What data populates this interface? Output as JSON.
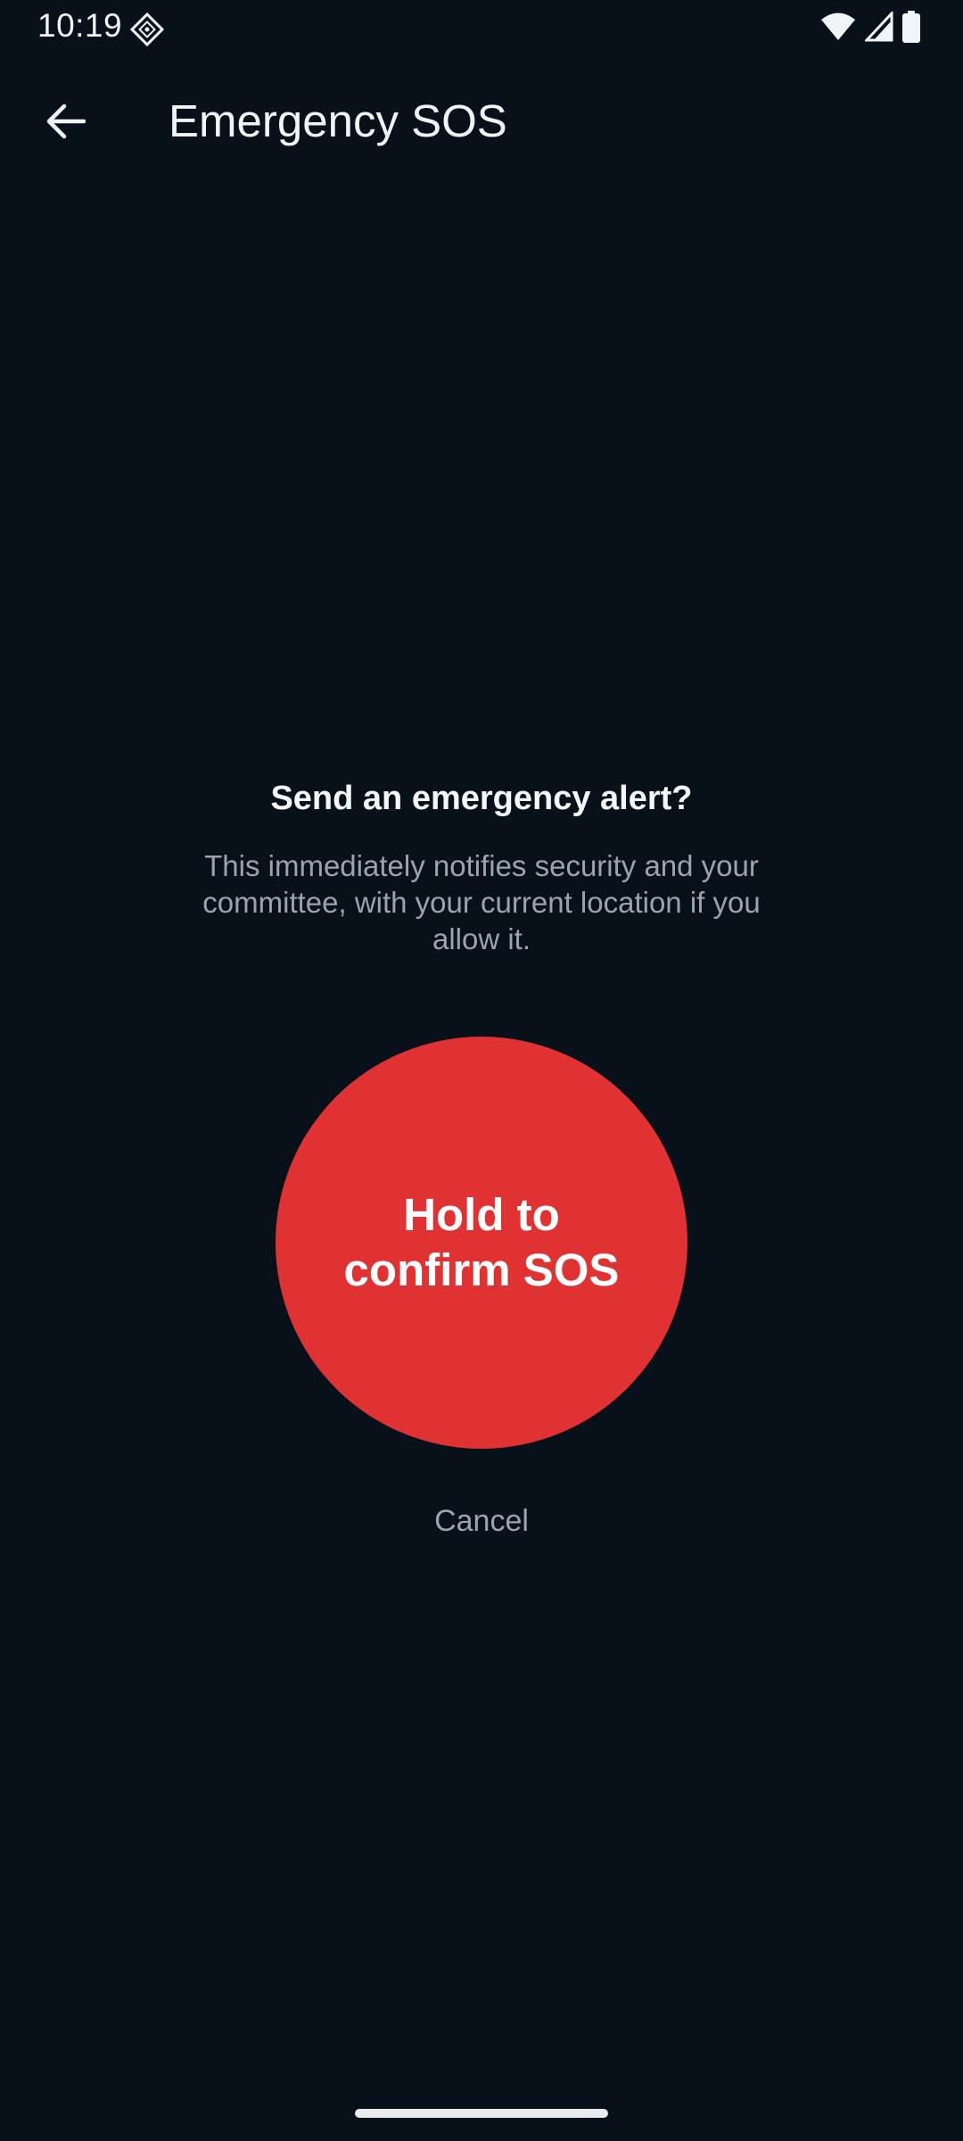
{
  "status_bar": {
    "time": "10:19",
    "notification_icon": "app-notification-icon",
    "icons": [
      "wifi-icon",
      "cell-signal-icon",
      "battery-icon"
    ]
  },
  "app_bar": {
    "back_icon": "arrow-back-icon",
    "title": "Emergency SOS"
  },
  "dialog": {
    "heading": "Send an emergency alert?",
    "description": "This immediately notifies security and your committee, with your current location if you allow it.",
    "sos_button_label": "Hold to confirm SOS",
    "cancel_label": "Cancel"
  },
  "colors": {
    "background": "#08101a",
    "sos_red": "#e03232",
    "muted_text": "#98a4b0",
    "primary_text": "#f2f5f7"
  }
}
